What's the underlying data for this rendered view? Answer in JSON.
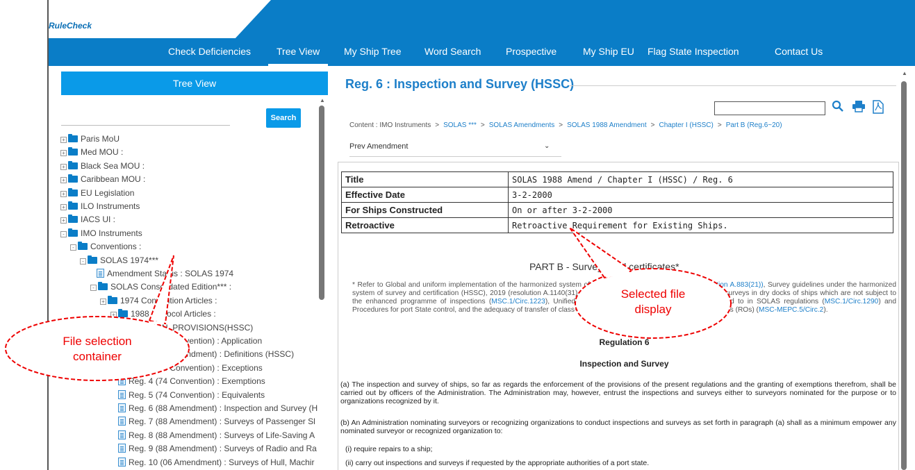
{
  "app": {
    "logo": "RuleCheck"
  },
  "nav": [
    {
      "label": "Check Deficiencies",
      "active": false
    },
    {
      "label": "Tree View",
      "active": true
    },
    {
      "label": "My Ship Tree",
      "active": false
    },
    {
      "label": "Word Search",
      "active": false
    },
    {
      "label": "Prospective",
      "active": false
    },
    {
      "label": "My Ship EU",
      "active": false
    },
    {
      "label": "Flag State Inspection",
      "active": false
    },
    {
      "label": "Contact Us",
      "active": false
    }
  ],
  "left": {
    "header": "Tree View",
    "search_button": "Search"
  },
  "tree": [
    {
      "label": "Paris MoU",
      "type": "folder",
      "exp": "+"
    },
    {
      "label": "Med MOU :",
      "type": "folder",
      "exp": "+"
    },
    {
      "label": "Black Sea MOU :",
      "type": "folder",
      "exp": "+"
    },
    {
      "label": "Caribbean MOU :",
      "type": "folder",
      "exp": "+"
    },
    {
      "label": "EU Legislation",
      "type": "folder",
      "exp": "+"
    },
    {
      "label": "ILO Instruments",
      "type": "folder",
      "exp": "+"
    },
    {
      "label": "IACS UI :",
      "type": "folder",
      "exp": "+"
    },
    {
      "label": "IMO Instruments",
      "type": "folder",
      "exp": "-"
    },
    {
      "label": "Conventions :",
      "type": "folder",
      "exp": "-"
    },
    {
      "label": "SOLAS 1974***",
      "type": "folder",
      "exp": "-"
    },
    {
      "label": "Amendment Status : SOLAS 1974",
      "type": "doc",
      "exp": ""
    },
    {
      "label": "SOLAS Consolidated Edition*** :",
      "type": "folder",
      "exp": "-"
    },
    {
      "label": "1974 Convention Articles :",
      "type": "folder",
      "exp": "+"
    },
    {
      "label": "1988 Protocol Articles :",
      "type": "folder",
      "exp": "+"
    },
    {
      "label": "GENERAL PROVISIONS(HSSC)",
      "type": "folder",
      "exp": "-"
    },
    {
      "label": "Reg. 1 (74 Convention) : Application",
      "type": "doc",
      "exp": ""
    },
    {
      "label": "Reg. 2 (88 Amendment) : Definitions (HSSC)",
      "type": "doc",
      "exp": ""
    },
    {
      "label": "Reg. 3 (74 Convention) : Exceptions",
      "type": "doc",
      "exp": ""
    },
    {
      "label": "Reg. 4 (74 Convention) : Exemptions",
      "type": "doc",
      "exp": ""
    },
    {
      "label": "Reg. 5 (74 Convention) : Equivalents",
      "type": "doc",
      "exp": ""
    },
    {
      "label": "Reg. 6 (88 Amendment) : Inspection and Survey (H",
      "type": "doc",
      "exp": ""
    },
    {
      "label": "Reg. 7 (88 Amendment) : Surveys of Passenger Sl",
      "type": "doc",
      "exp": ""
    },
    {
      "label": "Reg. 8 (88 Amendment) : Surveys of Life-Saving A",
      "type": "doc",
      "exp": ""
    },
    {
      "label": "Reg. 9 (88 Amendment) : Surveys of Radio and Ra",
      "type": "doc",
      "exp": ""
    },
    {
      "label": "Reg. 10 (06 Amendment) : Surveys of Hull, Machir",
      "type": "doc",
      "exp": ""
    }
  ],
  "main": {
    "title": "Reg. 6 : Inspection and Survey (HSSC)",
    "breadcrumb_prefix": "Content : IMO Instruments",
    "breadcrumb": [
      "SOLAS ***",
      "SOLAS Amendments",
      "SOLAS 1988 Amendment",
      "Chapter I (HSSC)",
      "Part B (Reg.6~20)"
    ],
    "prev_amendment": "Prev Amendment",
    "info": [
      {
        "k": "Title",
        "v": "SOLAS 1988 Amend / Chapter I (HSSC) / Reg. 6"
      },
      {
        "k": "Effective Date",
        "v": "3-2-2000"
      },
      {
        "k": "For Ships Constructed",
        "v": "On or after 3-2-2000"
      },
      {
        "k": "Retroactive",
        "v": "Retroactive Requirement for Existing Ships."
      }
    ],
    "part_heading": "PART B - Surveys and certificates*",
    "note_1": "* Refer to Global and uniform implementation of the harmonized system of survey and certification (HSSC) ",
    "note_link_1": "(resolution A.883(21))",
    "note_2": ", Survey guidelines under the harmonized system of survey and certification (HSSC), 2019 (resolution A.1140(31), as amended), Guidelines for pre-planning of surveys in dry docks of ships which are not subject to the enhanced programme of inspections (",
    "note_link_2": "MSC.1/Circ.1223",
    "note_3": "), Unified interpretation of the term \"first survey\" referred to in SOLAS regulations (",
    "note_link_3": "MSC.1/Circ.1290",
    "note_4": ") and Procedures for port State control, and the adequacy of transfer of class-related matters between recognized organizations (ROs) (",
    "note_link_4": "MSC-MEPC.5/Circ.2",
    "note_5": ").",
    "reg_heading": "Regulation 6",
    "reg_sub": "Inspection and Survey",
    "para_a": "(a) The inspection and survey of ships, so far as regards the enforcement of the provisions of the present regulations and the granting of exemptions therefrom, shall be carried out by officers of the Administration. The Administration may, however, entrust the inspections and surveys either to surveyors nominated for the purpose or to organizations recognized by it.",
    "para_b": "(b) An Administration nominating surveyors or recognizing organizations to conduct inspections and surveys as set forth in paragraph (a) shall as a minimum empower any nominated surveyor or recognized organization to:",
    "item_i": "(i) require repairs to a ship;",
    "item_ii": "(ii) carry out inspections and surveys if requested by the appropriate authorities of a port state."
  },
  "callouts": {
    "left": "File selection container",
    "right": "Selected file display"
  }
}
